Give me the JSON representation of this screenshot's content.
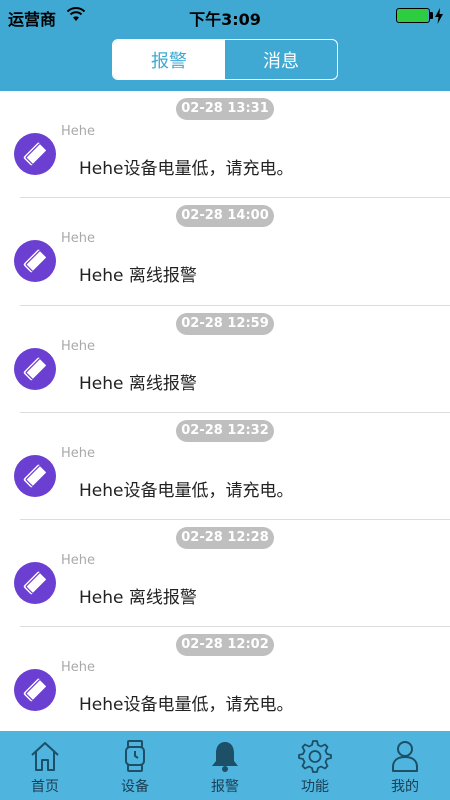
{
  "status_bar": {
    "carrier": "运营商",
    "time": "下午3:09",
    "battery_percent": 100
  },
  "segmented": {
    "tabs": [
      "报警",
      "消息"
    ],
    "active_index": 0
  },
  "items": [
    {
      "timestamp": "02-28 13:31",
      "sender": "Hehe",
      "message": "Hehe设备电量低，请充电。"
    },
    {
      "timestamp": "02-28 14:00",
      "sender": "Hehe",
      "message": "Hehe 离线报警"
    },
    {
      "timestamp": "02-28 12:59",
      "sender": "Hehe",
      "message": "Hehe 离线报警"
    },
    {
      "timestamp": "02-28 12:32",
      "sender": "Hehe",
      "message": "Hehe设备电量低，请充电。"
    },
    {
      "timestamp": "02-28 12:28",
      "sender": "Hehe",
      "message": "Hehe 离线报警"
    },
    {
      "timestamp": "02-28 12:02",
      "sender": "Hehe",
      "message": "Hehe设备电量低，请充电。"
    }
  ],
  "tabbar": [
    {
      "label": "首页",
      "icon": "home-icon"
    },
    {
      "label": "设备",
      "icon": "watch-icon"
    },
    {
      "label": "报警",
      "icon": "bell-icon"
    },
    {
      "label": "功能",
      "icon": "gear-icon"
    },
    {
      "label": "我的",
      "icon": "person-icon"
    }
  ],
  "colors": {
    "header": "#3fa9d3",
    "tabbar": "#4fb4de",
    "avatar": "#6a3fd1"
  }
}
